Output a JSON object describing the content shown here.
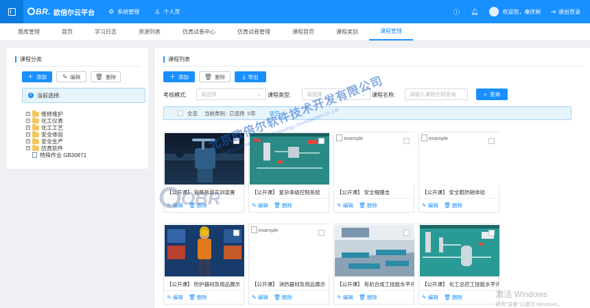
{
  "app": {
    "logo_mark": "BR.",
    "logo_text": "欧倍尔云平台",
    "menu_toggle_icon": "sidebar-toggle-icon"
  },
  "top_nav": [
    {
      "label": "系统管理",
      "icon": "gear-icon"
    },
    {
      "label": "个人页",
      "icon": "user-icon"
    }
  ],
  "top_right": {
    "help_icon": "help-circle-icon",
    "bell_icon": "bell-icon",
    "welcome": "欢迎您，秦庆新",
    "logout": "退出登录"
  },
  "tabs": [
    {
      "label": "题库管理",
      "active": false
    },
    {
      "label": "首页",
      "active": false
    },
    {
      "label": "学习日志",
      "active": false
    },
    {
      "label": "资源列表",
      "active": false
    },
    {
      "label": "仿真试卷中心",
      "active": false
    },
    {
      "label": "仿真试卷管理",
      "active": false
    },
    {
      "label": "课程首页",
      "active": false
    },
    {
      "label": "课程类别",
      "active": false
    },
    {
      "label": "课程管理",
      "active": true
    }
  ],
  "left_panel": {
    "title": "课程分类",
    "add": "添加",
    "edit": "编辑",
    "delete": "删除",
    "current_selection": "当前选择:",
    "tree": [
      {
        "label": "维修维护",
        "type": "folder"
      },
      {
        "label": "化工仪表",
        "type": "folder"
      },
      {
        "label": "化工工艺",
        "type": "folder"
      },
      {
        "label": "安全体验",
        "type": "folder"
      },
      {
        "label": "安全生产",
        "type": "folder"
      },
      {
        "label": "仿真软件",
        "type": "folder"
      },
      {
        "label": "特殊作业 GB30871",
        "type": "file"
      }
    ]
  },
  "right_panel": {
    "title": "课程列表",
    "add": "添加",
    "delete": "删除",
    "export": "导出",
    "filters": {
      "mode_label": "考核模式:",
      "mode_placeholder": "请选择",
      "type_label": "课程类型:",
      "type_placeholder": "请选择",
      "name_label": "课程名称:",
      "name_placeholder": "请输入课程名称查询",
      "search": "查询"
    },
    "bar": {
      "select_all": "全选",
      "current_category": "当前类别:",
      "selected": "已选择",
      "count": "0项",
      "clear": "清空"
    },
    "edit_label": "编辑",
    "delete_label": "删除",
    "courses": [
      {
        "title": "【公开课】 管路拆装实训装置",
        "image": "valve-photo",
        "broken": false
      },
      {
        "title": "【公开课】 复杂串级控制系统",
        "image": "control-system-screen",
        "broken": false
      },
      {
        "title": "【公开课】 安全帽撞击",
        "image": "example",
        "broken": true
      },
      {
        "title": "【公开课】 安全鞋防砸体验",
        "image": "example",
        "broken": true
      },
      {
        "title": "【公开课】 防护器材及用品展示",
        "image": "protective-gear-photo",
        "broken": false
      },
      {
        "title": "【公开课】 消防器材及用品展示",
        "image": "example",
        "broken": true
      },
      {
        "title": "【公开课】 有机合成工技能水平评价",
        "image": "lab-room-photo",
        "broken": false
      },
      {
        "title": "【公开课】 化工总控工技能水平评价",
        "image": "process-flow-screen",
        "broken": false
      }
    ]
  },
  "watermark": {
    "company": "北京欧倍尔软件技术开发有限公司",
    "company_en": "Beijing Oubeier Software Technology Development Co.,Ltd.",
    "logo_text": "OBR."
  },
  "windows_watermark": {
    "line1": "激活 Windows",
    "line2": "转到\"设置\"以激活 Windows。"
  }
}
